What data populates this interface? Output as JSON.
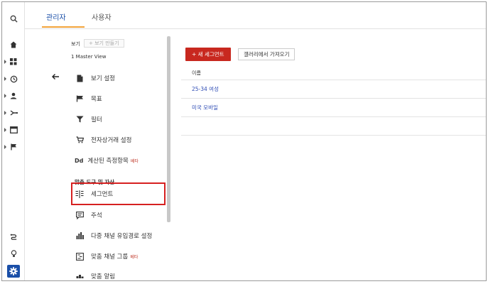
{
  "tabs": [
    {
      "label": "관리자"
    },
    {
      "label": "사용자"
    }
  ],
  "view": {
    "label": "보기",
    "create_button": "+ 보기 만들기",
    "selected": "1 Master View"
  },
  "menu": {
    "items": [
      {
        "label": "보기 설정",
        "icon": "document-icon"
      },
      {
        "label": "목표",
        "icon": "flag-icon"
      },
      {
        "label": "필터",
        "icon": "filter-icon"
      },
      {
        "label": "전자상거래 설정",
        "icon": "cart-icon"
      },
      {
        "label": "계산된 측정항목",
        "beta": "베타",
        "icon": "dd-icon"
      }
    ],
    "section_title": "맞춤 도구 및 자산",
    "tool_items": [
      {
        "label": "세그먼트",
        "icon": "segment-icon"
      },
      {
        "label": "주석",
        "icon": "annotation-icon"
      },
      {
        "label": "다중 채널 유입경로 설정",
        "icon": "bar-chart-icon"
      },
      {
        "label": "맞춤 채널 그룹",
        "beta": "베타",
        "icon": "channel-group-icon"
      },
      {
        "label": "맞춤 알림",
        "icon": "alert-icon"
      }
    ],
    "dd_text": "Dd"
  },
  "content": {
    "new_segment_button": "+ 새 세그먼트",
    "gallery_button": "갤러리에서 가져오기",
    "table_header": "이름",
    "rows": [
      {
        "name": "25-34 여성"
      },
      {
        "name": "미국 모바일"
      }
    ]
  },
  "colors": {
    "accent_blue": "#1a4fa8",
    "tab_underline": "#f2a33a",
    "primary_red": "#c8281f",
    "highlight_red": "#d62020",
    "link_blue": "#2f4db5"
  }
}
